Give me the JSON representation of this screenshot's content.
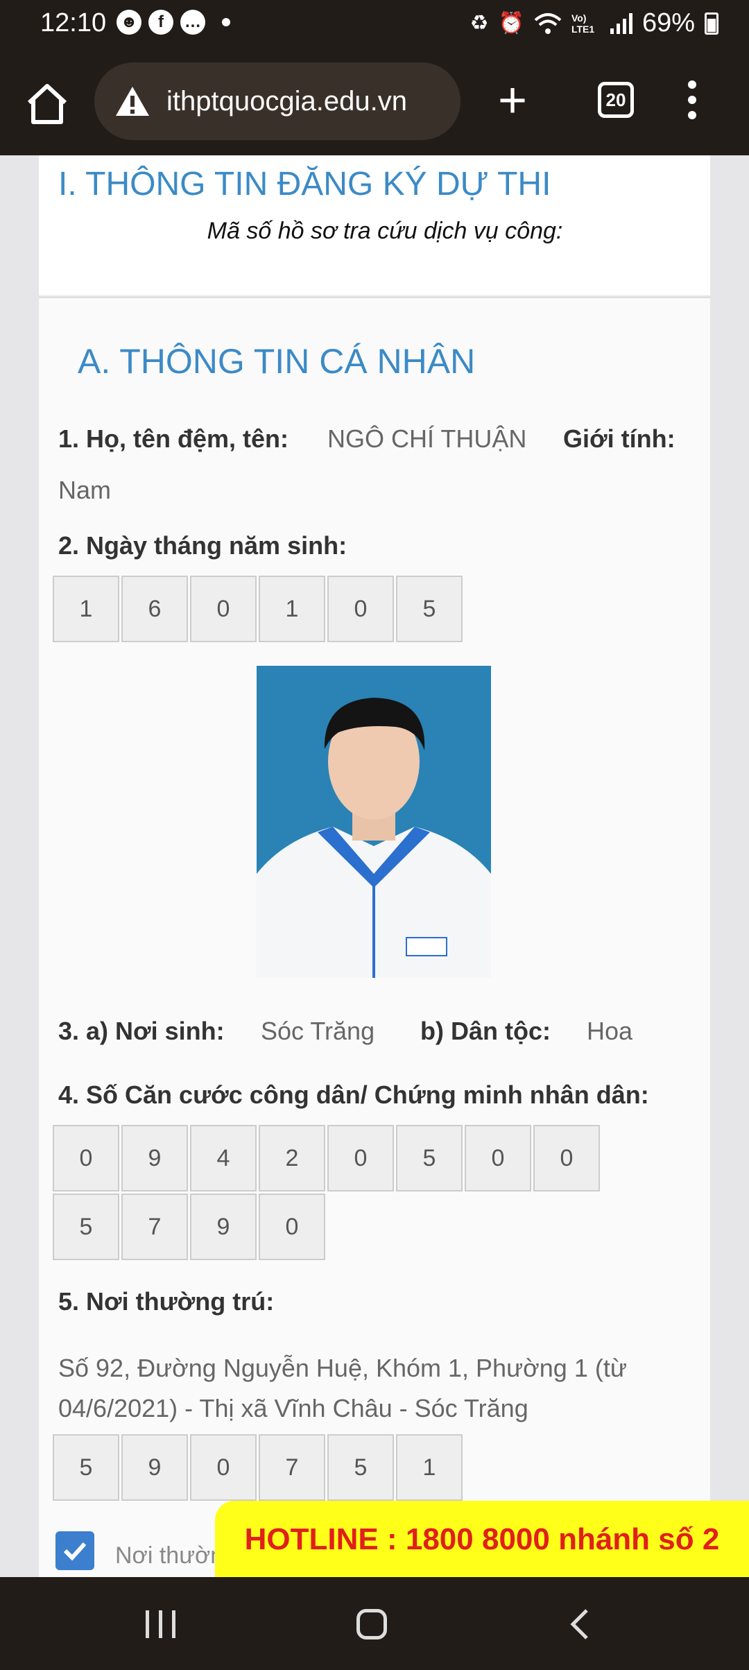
{
  "status": {
    "time": "12:10",
    "battery": "69%",
    "notif_icons": [
      "octopus-icon",
      "facebook-icon",
      "messenger-icon",
      "dot-icon"
    ],
    "system_icons": [
      "recycle-icon",
      "alarm-icon",
      "wifi-icon",
      "volte-icon",
      "signal-icon",
      "battery-icon"
    ],
    "volte": "Vo) LTE1"
  },
  "browser": {
    "url": "ithptquocgia.edu.vn",
    "tab_count": "20"
  },
  "page": {
    "section_title": "I. THÔNG TIN ĐĂNG KÝ DỰ THI",
    "record_label": "Mã số hồ sơ tra cứu dịch vụ công:",
    "personal_title": "A. THÔNG TIN CÁ NHÂN",
    "name_label": "1. Họ, tên đệm, tên:",
    "name_value": "NGÔ CHÍ THUẬN",
    "gender_label": "Giới tính:",
    "gender_value": "Nam",
    "dob_label": "2. Ngày tháng năm sinh:",
    "dob_digits": [
      "1",
      "6",
      "0",
      "1",
      "0",
      "5"
    ],
    "birthplace_label": "3. a) Nơi sinh:",
    "birthplace_value": "Sóc Trăng",
    "ethnicity_label": "b) Dân tộc:",
    "ethnicity_value": "Hoa",
    "id_label": "4. Số Căn cước công dân/ Chứng minh nhân dân:",
    "id_digits": [
      "0",
      "9",
      "4",
      "2",
      "0",
      "5",
      "0",
      "0",
      "5",
      "7",
      "9",
      "0"
    ],
    "residence_label": "5. Nơi thường trú:",
    "residence_value": "Số 92, Đường Nguyễn Huệ, Khóm 1, Phường 1 (từ 04/6/2021) - Thị xã Vĩnh Châu - Sóc Trăng",
    "residence_code": [
      "5",
      "9",
      "0",
      "7",
      "5",
      "1"
    ],
    "checkbox_label": "Nơi thường",
    "hotline": "HOTLINE : 1800 8000 nhánh số 2"
  },
  "colors": {
    "heading_blue": "#3b8ac6",
    "hotline_bg": "#ffff1a",
    "hotline_text": "#e0201a",
    "bar_bg": "#221c18"
  }
}
